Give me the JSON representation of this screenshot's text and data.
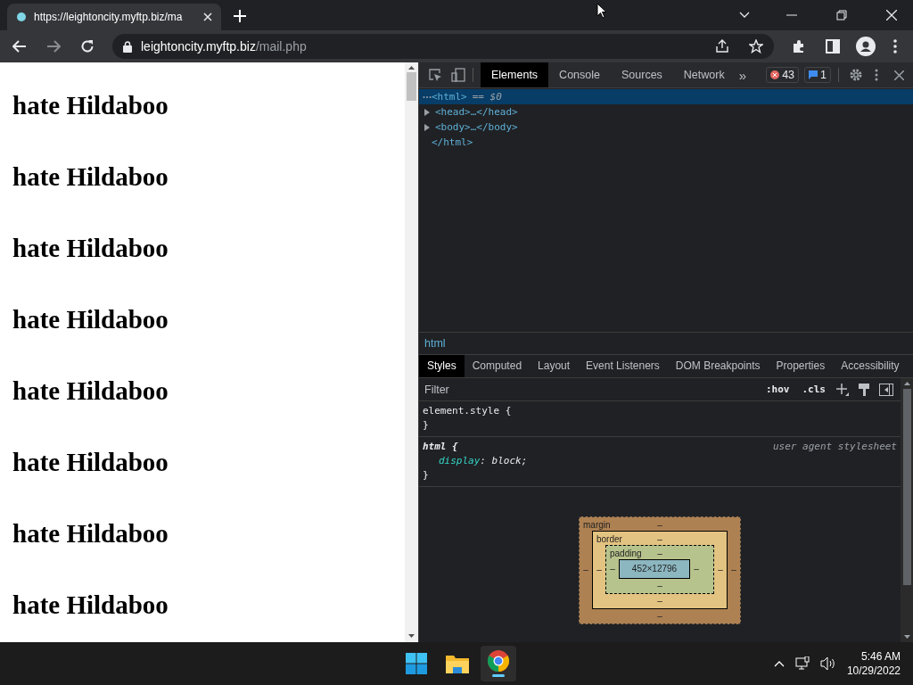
{
  "browser": {
    "tab": {
      "title": "https://leightoncity.myftp.biz/ma",
      "selected": true
    },
    "address": {
      "host": "leightoncity.myftp.biz",
      "path": "/mail.php"
    }
  },
  "page": {
    "headings": [
      "hate Hildaboo",
      "hate Hildaboo",
      "hate Hildaboo",
      "hate Hildaboo",
      "hate Hildaboo",
      "hate Hildaboo",
      "hate Hildaboo",
      "hate Hildaboo"
    ]
  },
  "devtools": {
    "tabs": [
      {
        "label": "Elements",
        "selected": true
      },
      {
        "label": "Console",
        "selected": false
      },
      {
        "label": "Sources",
        "selected": false
      },
      {
        "label": "Network",
        "selected": false
      }
    ],
    "overflow": "»",
    "errors": "43",
    "messages": "1",
    "dom": {
      "open": "<html>",
      "marker": "== $0",
      "selected": true,
      "children": [
        {
          "text": "<head>…</head>",
          "expanded": false,
          "selected": false
        },
        {
          "text": "<body>…</body>",
          "expanded": false,
          "selected": false
        }
      ],
      "close": "</html>"
    },
    "breadcrumb": "html",
    "sidebar_tabs": [
      {
        "label": "Styles",
        "selected": true
      },
      {
        "label": "Computed",
        "selected": false
      },
      {
        "label": "Layout",
        "selected": false
      },
      {
        "label": "Event Listeners",
        "selected": false
      },
      {
        "label": "DOM Breakpoints",
        "selected": false
      },
      {
        "label": "Properties",
        "selected": false
      },
      {
        "label": "Accessibility",
        "selected": false
      }
    ],
    "filter": {
      "placeholder": "Filter"
    },
    "hov": ":hov",
    "cls": ".cls",
    "rules": [
      {
        "kind": "inline",
        "header": "element.style {",
        "footer": "}"
      },
      {
        "kind": "user-agent",
        "header": "html {",
        "origin": "user agent stylesheet",
        "declarations": [
          {
            "property": "display",
            "rest": ": block;"
          }
        ],
        "footer": "}"
      }
    ],
    "box_model": {
      "margin": {
        "label": "margin",
        "top": "–",
        "right": "–",
        "bottom": "–",
        "left": "–"
      },
      "border": {
        "label": "border",
        "top": "–",
        "right": "–",
        "bottom": "–",
        "left": "–"
      },
      "padding": {
        "label": "padding",
        "top": "–",
        "right": "–",
        "bottom": "–",
        "left": "–"
      },
      "content": "452×12796"
    }
  },
  "taskbar": {
    "time": "5:46 AM",
    "date": "10/29/2022"
  }
}
